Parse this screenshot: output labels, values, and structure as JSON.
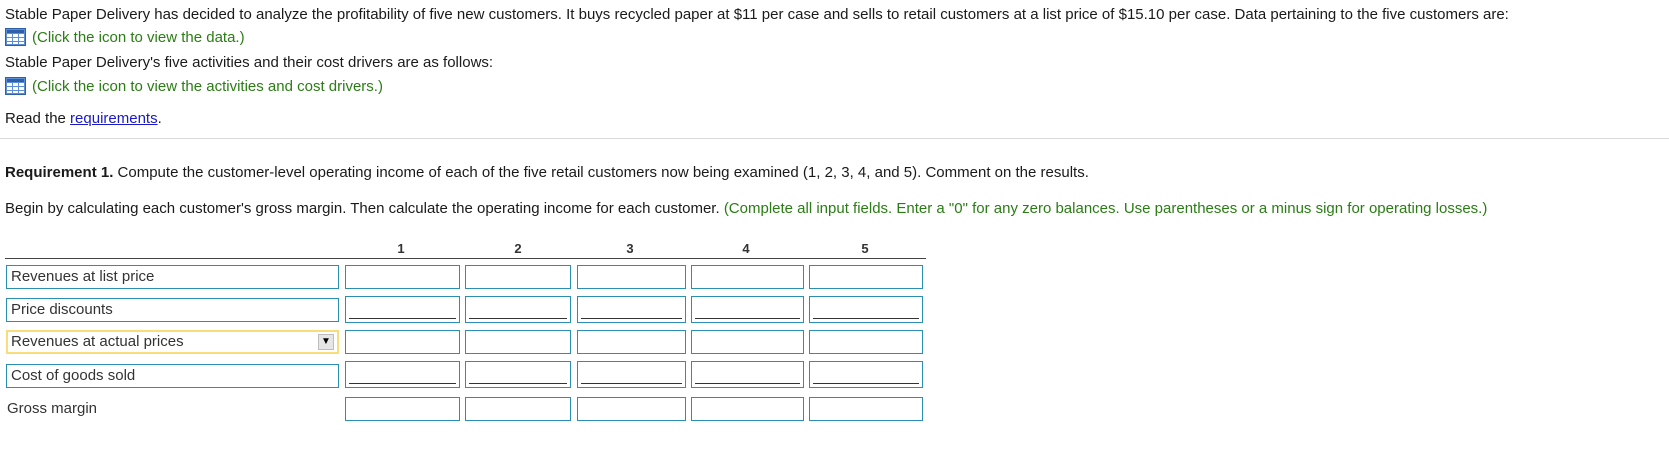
{
  "intro": {
    "line1": "Stable Paper Delivery has decided to analyze the profitability of five new customers. It buys recycled paper at $11 per case and sells to retail customers at a list price of $15.10 per case. Data pertaining to the five customers are:",
    "data_link": "(Click the icon to view the data.)",
    "line2": "Stable Paper Delivery's five activities and their cost drivers are as follows:",
    "activities_link": "(Click the icon to view the activities and cost drivers.)",
    "read_prefix": "Read the ",
    "requirements_link": "requirements",
    "read_suffix": "."
  },
  "requirement": {
    "label": "Requirement 1.",
    "text": " Compute the customer-level operating income of each of the five retail customers now being examined (1, 2, 3, 4, and 5). Comment on the results."
  },
  "instruction": {
    "text": "Begin by calculating each customer's gross margin. Then calculate the operating income for each customer. ",
    "hint": "(Complete all input fields. Enter a \"0\" for any zero balances. Use parentheses or a minus sign for operating losses.)"
  },
  "table": {
    "columns": [
      "1",
      "2",
      "3",
      "4",
      "5"
    ],
    "rows": [
      {
        "label": "Revenues at list price"
      },
      {
        "label": "Price discounts"
      },
      {
        "label": "Revenues at actual prices"
      },
      {
        "label": "Cost of goods sold"
      },
      {
        "label": "Gross margin"
      }
    ]
  },
  "icons": {
    "data_icon": "table-grid-icon",
    "activities_icon": "table-grid-icon",
    "dropdown_icon": "triangle-down"
  },
  "colors": {
    "green_text": "#2a7d14",
    "input_border": "#2b8fb3",
    "link": "#1a1acc",
    "selected_border": "#f7de7a"
  }
}
